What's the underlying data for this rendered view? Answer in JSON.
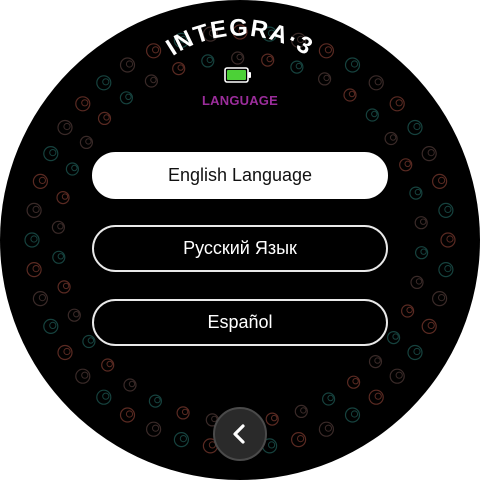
{
  "header": {
    "brand": "INTEGRA·3",
    "screen_title": "LANGUAGE",
    "title_color": "#9b2d9b",
    "battery_color": "#4cd137"
  },
  "languages": [
    {
      "label": "English Language",
      "selected": true
    },
    {
      "label": "Русский Язык",
      "selected": false
    },
    {
      "label": "Español",
      "selected": false
    }
  ],
  "back_button": {
    "icon": "chevron-left-icon"
  },
  "decor": {
    "ring_colors": [
      "#5a2a22",
      "#16423e",
      "#3a2a28"
    ]
  }
}
